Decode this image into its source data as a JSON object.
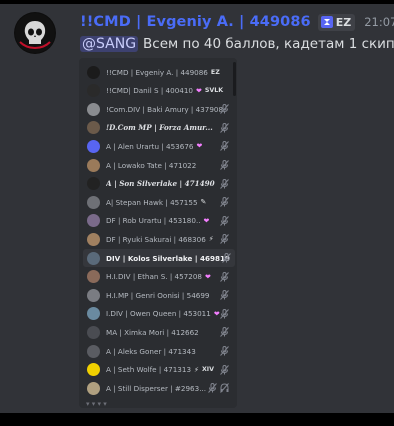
{
  "message": {
    "author": "!!CMD | Evgeniy A. | 449086",
    "server_tag": "EZ",
    "time": "21:07",
    "mention": "@SANG",
    "text": "Всем по 40 баллов, кадетам 1 скип"
  },
  "members": [
    {
      "name": "!!CMD | Evgeniy A. | 449086",
      "tag": "EZ",
      "tag_glyph": "",
      "style": "normal",
      "avatar_color": "#1b1b1b",
      "muted": false
    },
    {
      "name": "!!CMD| Danil S | 400410",
      "tag": "SVLK",
      "tag_glyph": "❤",
      "style": "normal",
      "avatar_color": "#2a2a2a",
      "muted": false
    },
    {
      "name": "!Com.DIV | Baki Amury | 437908",
      "tag": "",
      "tag_glyph": "",
      "style": "normal",
      "avatar_color": "#8a8c90",
      "muted": true
    },
    {
      "name": "!D.Com MP | Forza Amur...",
      "tag": "",
      "tag_glyph": "",
      "style": "fancy",
      "avatar_color": "#6b5a4a",
      "muted": true
    },
    {
      "name": "A | Alen Urartu | 453676",
      "tag": "",
      "tag_glyph": "❤",
      "style": "normal",
      "avatar_color": "#5865f2",
      "muted": true
    },
    {
      "name": "A | Lowako Tate | 471022",
      "tag": "",
      "tag_glyph": "",
      "style": "normal",
      "avatar_color": "#9a7a5a",
      "muted": true
    },
    {
      "name": "A | Son Silverlake | 471490",
      "tag": "",
      "tag_glyph": "",
      "style": "fancy",
      "avatar_color": "#222222",
      "muted": true
    },
    {
      "name": "A| Stepan Hawk | 457155",
      "tag": "",
      "tag_glyph": "✎",
      "style": "normal",
      "avatar_color": "#6e7076",
      "muted": true
    },
    {
      "name": "DF | Rob Urartu | 453180..",
      "tag": "",
      "tag_glyph": "❤",
      "style": "normal",
      "avatar_color": "#7a6a8a",
      "muted": true
    },
    {
      "name": "DF | Ryuki Sakurai | 468306",
      "tag": "",
      "tag_glyph": "⚡",
      "style": "normal",
      "avatar_color": "#a08060",
      "muted": true
    },
    {
      "name": "DIV | Kolos Silverlake | 469819",
      "tag": "",
      "tag_glyph": "",
      "style": "bold",
      "avatar_color": "#5a6a7a",
      "muted": true
    },
    {
      "name": "H.I.DIV | Ethan S. | 457208",
      "tag": "",
      "tag_glyph": "❤",
      "style": "normal",
      "avatar_color": "#8a6a5a",
      "muted": true
    },
    {
      "name": "H.I.MP | Genri Oonisi | 54699",
      "tag": "",
      "tag_glyph": "",
      "style": "normal",
      "avatar_color": "#7a7c82",
      "muted": true
    },
    {
      "name": "I.DIV | Owen Queen | 453011",
      "tag": "",
      "tag_glyph": "❤",
      "style": "normal",
      "avatar_color": "#6a8aa0",
      "muted": true
    },
    {
      "name": "MA | Ximka Mori | 412662",
      "tag": "",
      "tag_glyph": "",
      "style": "normal",
      "avatar_color": "#4a4c52",
      "muted": true
    },
    {
      "name": "A | Aleks Goner | 471343",
      "tag": "",
      "tag_glyph": "",
      "style": "normal",
      "avatar_color": "#5a5c62",
      "muted": true
    },
    {
      "name": "A | Seth Wolfe | 471313",
      "tag": "XIV",
      "tag_glyph": "⚡",
      "style": "normal",
      "avatar_color": "#f0d000",
      "muted": true
    },
    {
      "name": "A | Still Disperser | #2963...",
      "tag": "",
      "tag_glyph": "",
      "style": "normal",
      "avatar_color": "#b0a080",
      "muted": true
    }
  ],
  "colors": {
    "background": "#313338",
    "author": "#4a6cf7",
    "mention_bg": "#3e4270",
    "muted_icon": "#80848e"
  }
}
